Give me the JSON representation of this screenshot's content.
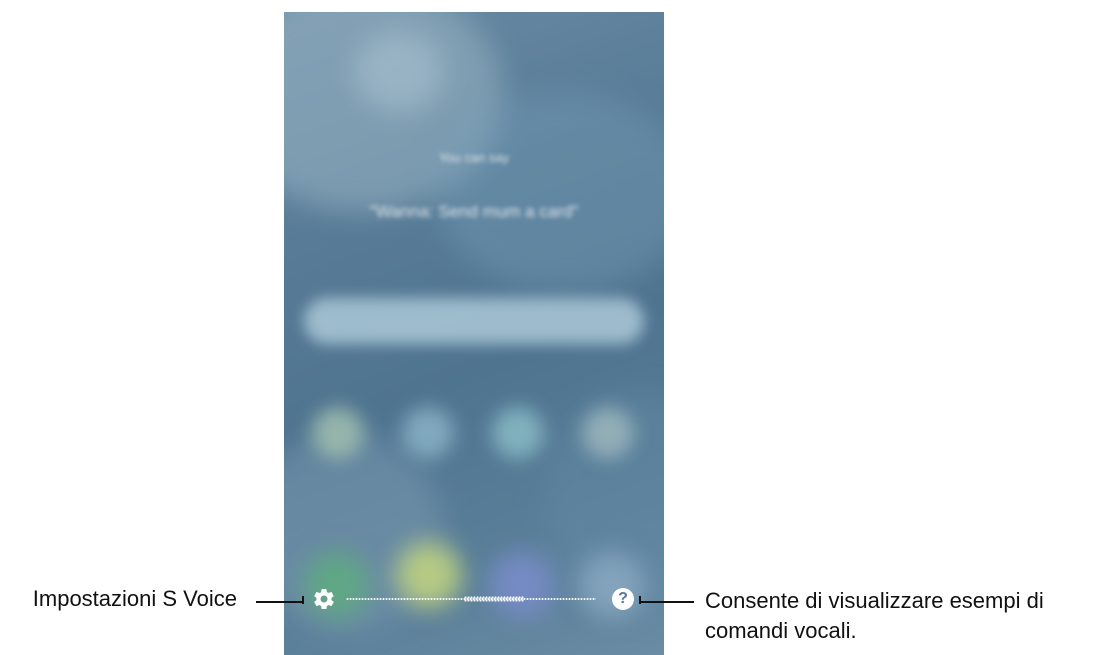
{
  "phone": {
    "hint_small": "You can say",
    "hint_quote": "\"Wanna: Send mum a card\""
  },
  "controls": {
    "settings_icon": "gear-icon",
    "help_icon": "question-circle-icon",
    "help_glyph": "?"
  },
  "callouts": {
    "left": "Impostazioni S Voice",
    "right_line1": "Consente di visualizzare esempi di",
    "right_line2": "comandi vocali."
  }
}
